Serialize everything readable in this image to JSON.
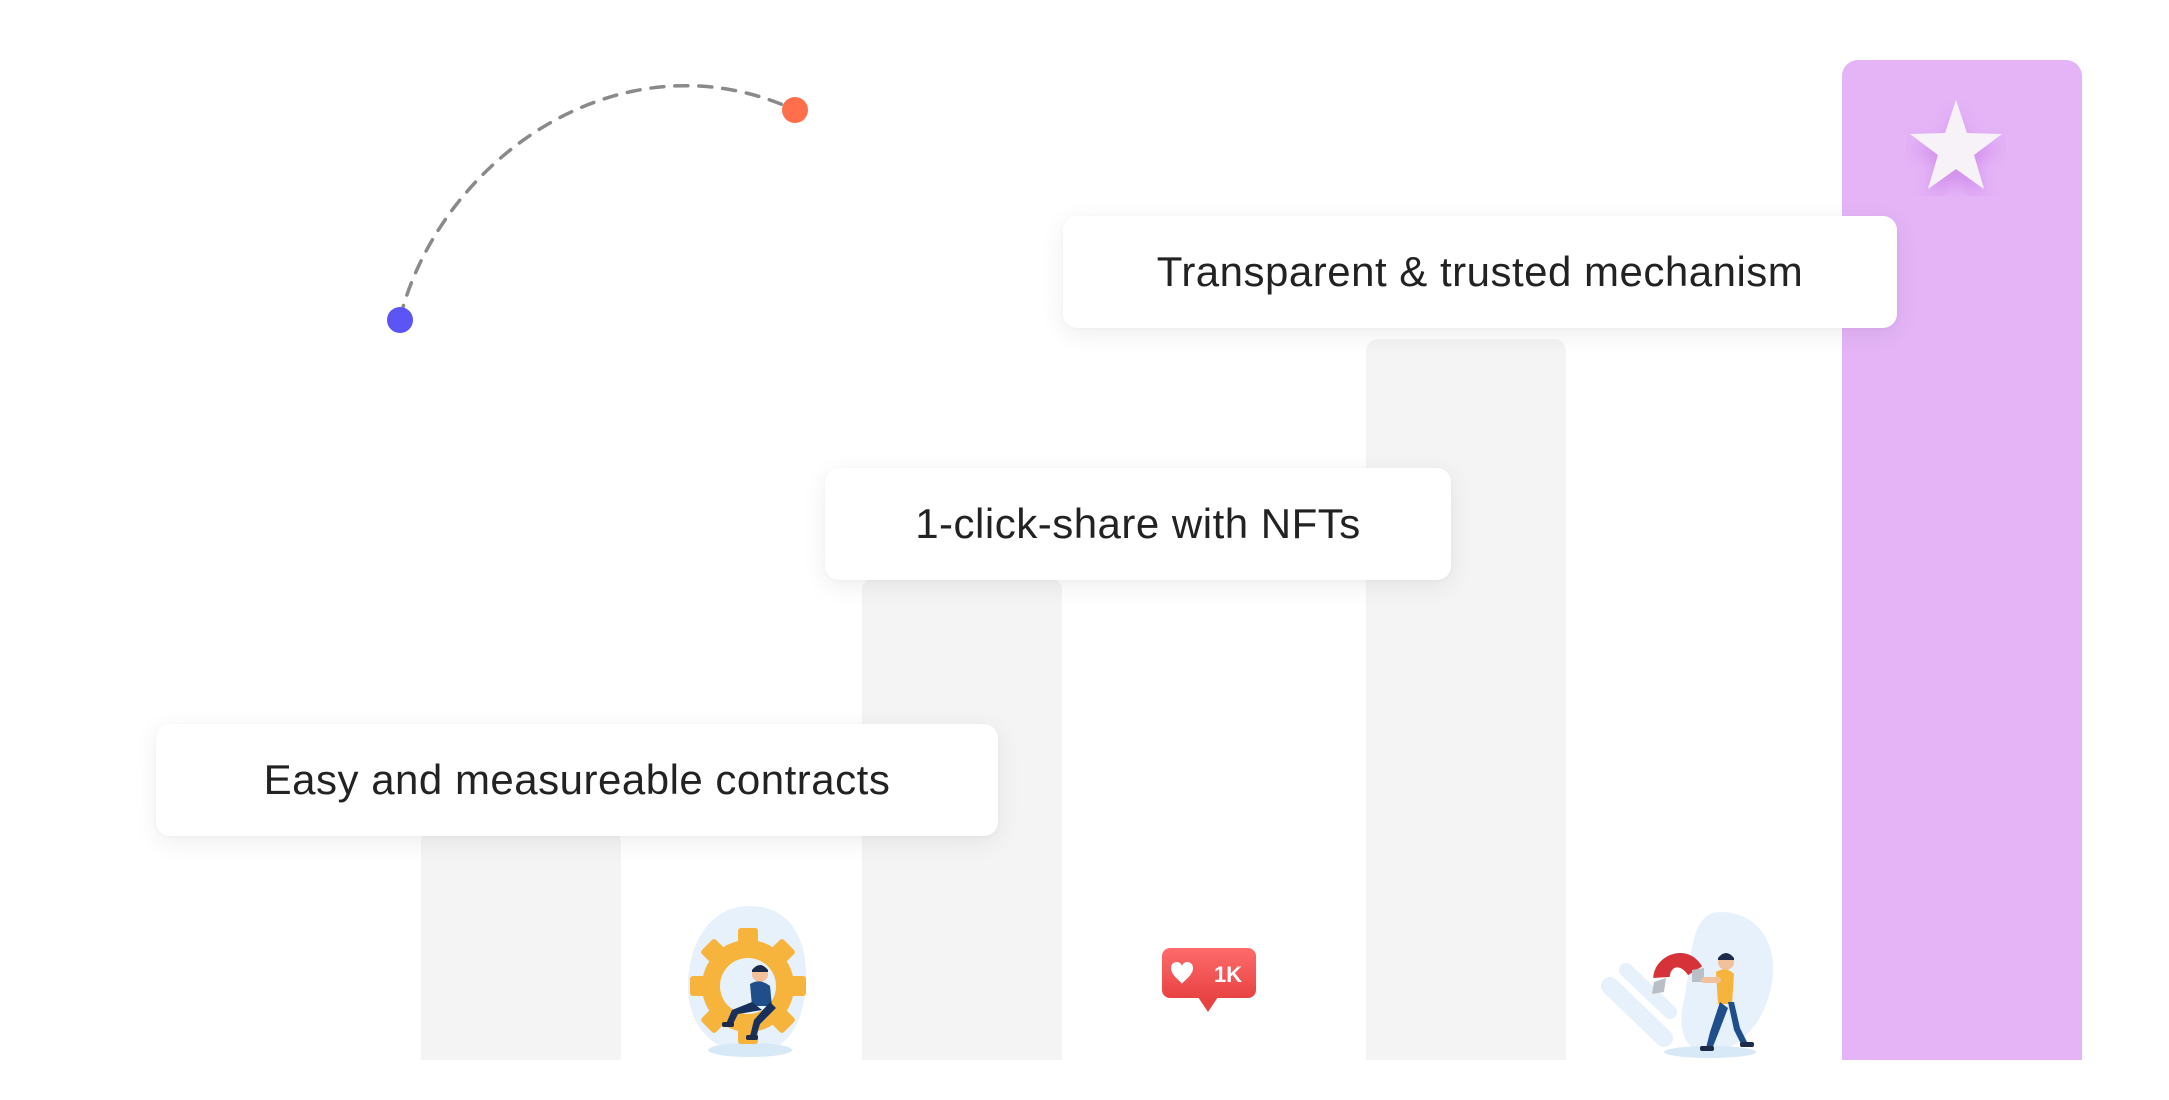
{
  "steps": [
    {
      "label": "Easy and measureable contracts",
      "icon": "gear-person-icon"
    },
    {
      "label": "1-click-share with NFTs",
      "icon": "like-1k-badge-icon"
    },
    {
      "label": "Transparent & trusted mechanism",
      "icon": "magnet-person-icon"
    }
  ],
  "badge_text": "1K",
  "colors": {
    "bar": "#f4f4f4",
    "highlight_bar": "#e4b4f7",
    "dot_start": "#5b55f5",
    "dot_end": "#ff6f4b",
    "text": "#222222"
  }
}
